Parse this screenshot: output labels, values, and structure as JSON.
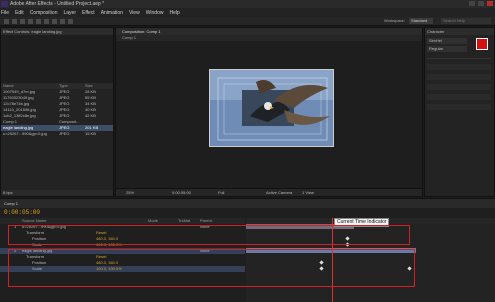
{
  "window": {
    "title": "Adobe After Effects - Untitled Project.aep *"
  },
  "menu": [
    "File",
    "Edit",
    "Composition",
    "Layer",
    "Effect",
    "Animation",
    "View",
    "Window",
    "Help"
  ],
  "toolbar": {
    "workspace_label": "Workspace:",
    "workspace_value": "Standard",
    "search_placeholder": "Search Help"
  },
  "project": {
    "tab": "Effect Controls: eagle landing.jpg",
    "columns": [
      "Name",
      "Type",
      "Size"
    ],
    "files": [
      {
        "name": "1007549_d7m.jpg",
        "type": "JPEG",
        "size": "28 KB"
      },
      {
        "name": "11750023049.jpg",
        "type": "JPEG",
        "size": "55 KB"
      },
      {
        "name": "12c78e74b.jpg",
        "type": "JPEG",
        "size": "34 KB"
      },
      {
        "name": "14110_201506.jpg",
        "type": "JPEG",
        "size": "40 KB"
      },
      {
        "name": "1cb2_13ff2c8e.jpg",
        "type": "JPEG",
        "size": "42 KB"
      },
      {
        "name": "Comp 1",
        "type": "Composit...",
        "size": ""
      },
      {
        "name": "eagle landing.jpg",
        "type": "JPEG",
        "size": "201 KB"
      },
      {
        "name": "u=25267...990&gp=0.jpg",
        "type": "JPEG",
        "size": "15 KB"
      }
    ],
    "footer": "8 bpc"
  },
  "viewer": {
    "tab": "Composition: Comp 1",
    "subtab": "Comp 1",
    "zoom": "25%",
    "timecode": "0:00:05:00",
    "resolution": "Full",
    "camera": "Active Camera",
    "views": "1 View"
  },
  "character": {
    "tab": "Character",
    "font": "SimHei",
    "style": "Regular"
  },
  "timeline": {
    "tab": "Comp 1",
    "timecode": "0:00:05:00",
    "columns": [
      "Source Name",
      "Mode",
      "TrkMat",
      "Parent"
    ],
    "layers": [
      {
        "num": "1",
        "name": "u=25267...990&gp=0.jpg",
        "parent": "None"
      },
      {
        "num": "",
        "name": "Transform",
        "value": "Reset"
      },
      {
        "num": "",
        "name": "Position",
        "value": "480.0, 360.0"
      },
      {
        "num": "",
        "name": "Scale",
        "value": "100.0, 100.0%"
      },
      {
        "num": "2",
        "name": "eagle landing.jpg",
        "parent": "None"
      },
      {
        "num": "",
        "name": "Transform",
        "value": "Reset"
      },
      {
        "num": "",
        "name": "Position",
        "value": "480.0, 360.0"
      },
      {
        "num": "",
        "name": "Scale",
        "value": "100.0, 100.0%"
      }
    ],
    "tooltip": "Current Time Indicator"
  },
  "colors": {
    "accent": "#d42020",
    "timecode": "#e0a020",
    "selection": "#3d4d6a"
  }
}
